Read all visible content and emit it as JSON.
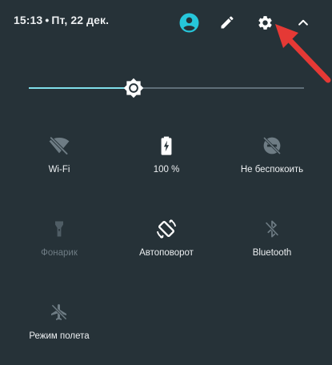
{
  "header": {
    "time": "15:13",
    "separator": "•",
    "date": "Пт, 22 дек."
  },
  "icons": {
    "user": "account-circle-icon",
    "edit": "pencil-icon",
    "settings": "gear-icon",
    "collapse": "chevron-up-icon",
    "brightness": "brightness-icon"
  },
  "brightness": {
    "level_percent": 38
  },
  "tiles": [
    {
      "label": "Wi-Fi",
      "icon": "wifi-off-icon",
      "state": "off"
    },
    {
      "label": "100 %",
      "icon": "battery-charging-icon",
      "state": "on"
    },
    {
      "label": "Не беспокоить",
      "icon": "do-not-disturb-off-icon",
      "state": "off"
    },
    {
      "label": "Фонарик",
      "icon": "flashlight-icon",
      "state": "unavailable"
    },
    {
      "label": "Автоповорот",
      "icon": "screen-rotation-icon",
      "state": "on"
    },
    {
      "label": "Bluetooth",
      "icon": "bluetooth-off-icon",
      "state": "off"
    },
    {
      "label": "Режим полета",
      "icon": "airplane-mode-off-icon",
      "state": "off"
    }
  ],
  "colors": {
    "background": "#263238",
    "accent": "#80deea",
    "avatar": "#26c6da",
    "arrow": "#e53935",
    "icon_off": "#6e7c84",
    "text": "#eceff1"
  }
}
